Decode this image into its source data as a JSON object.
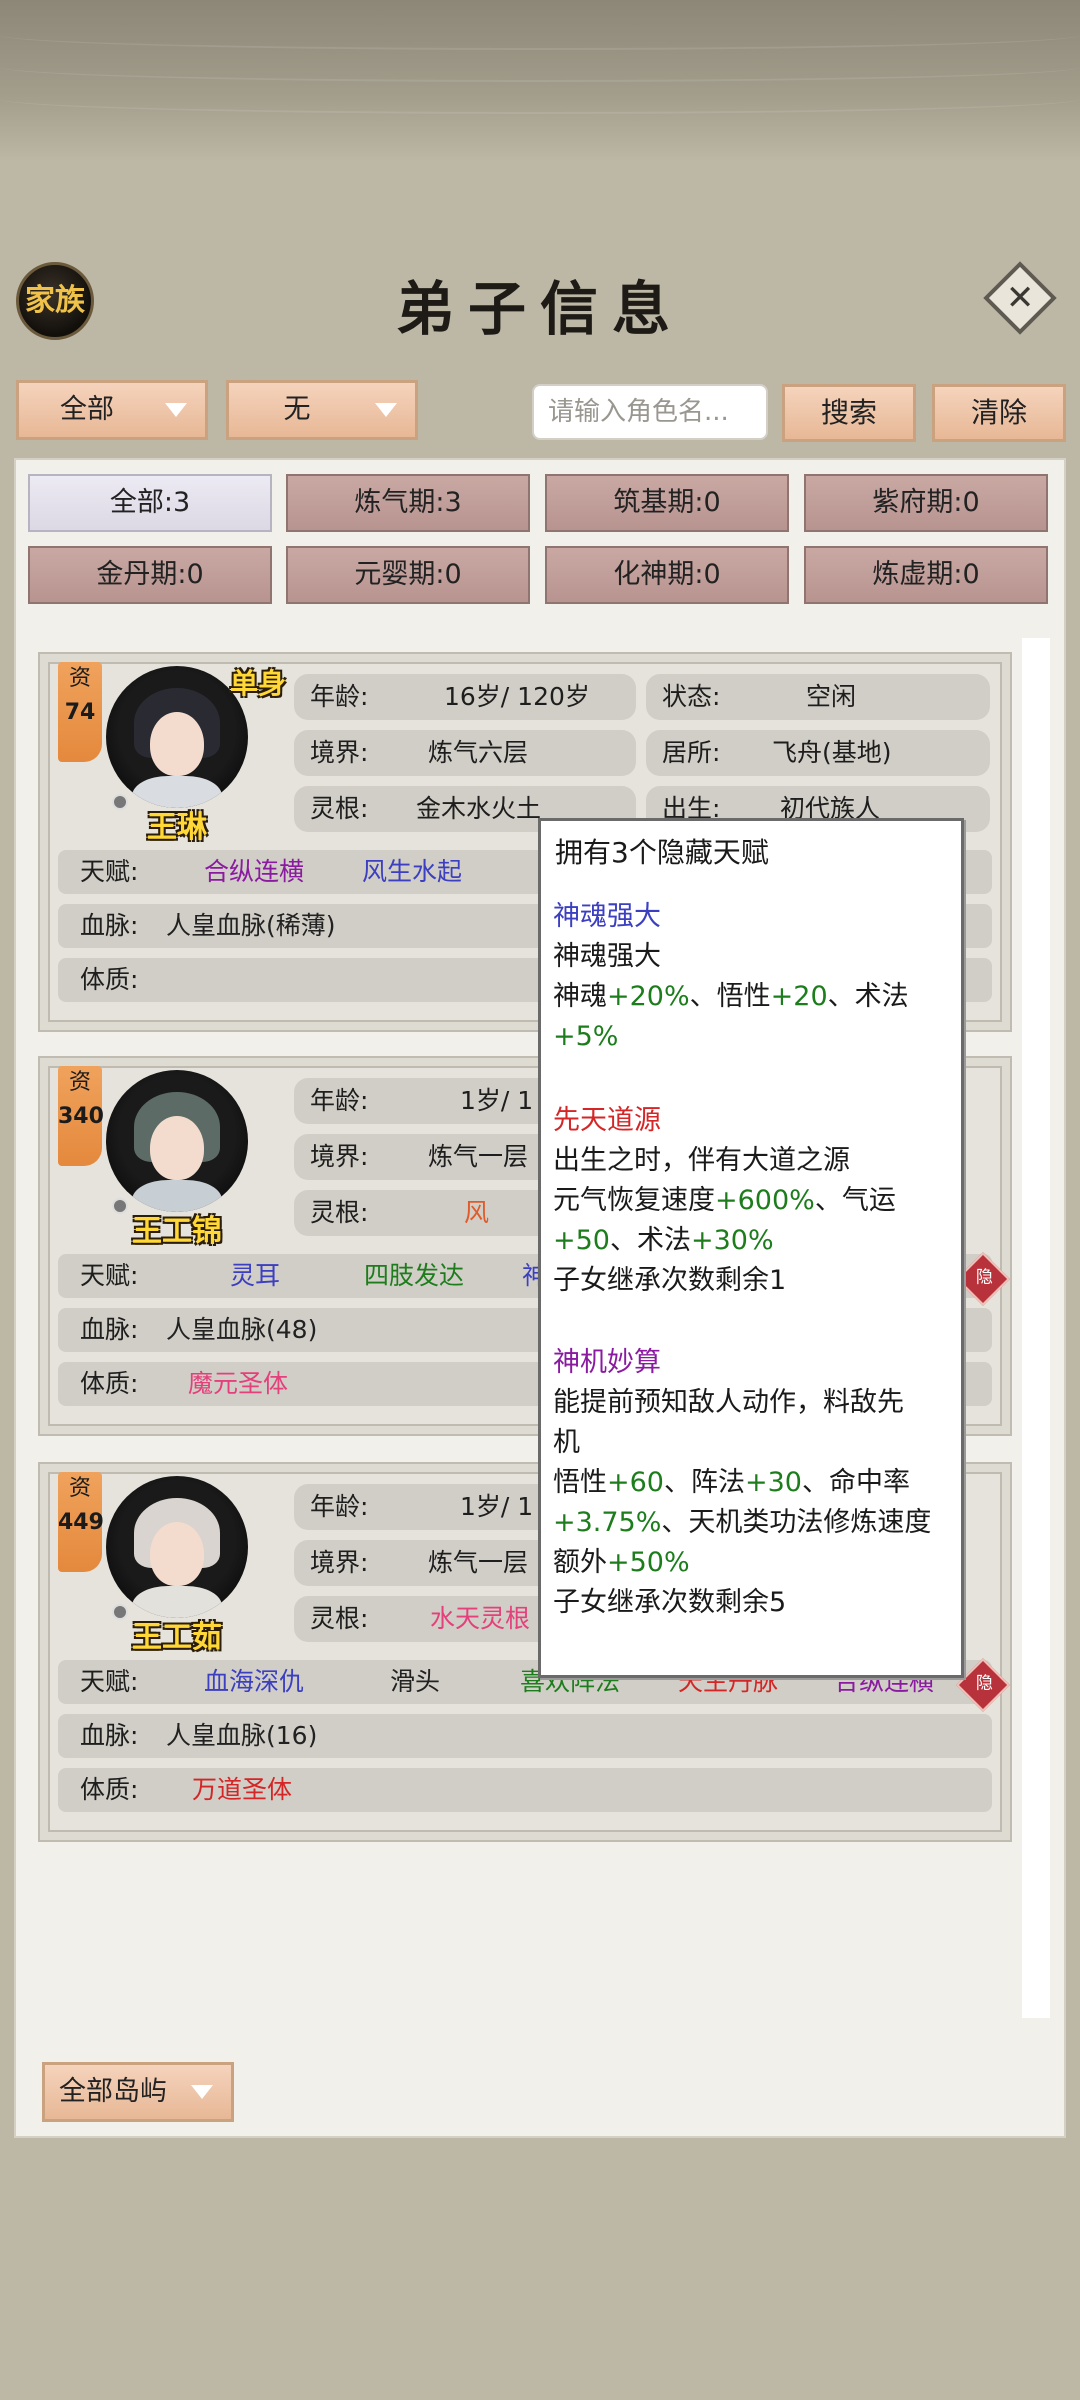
{
  "header": {
    "family_label": "家族",
    "title": "弟子信息"
  },
  "filters": {
    "group_dropdown": "全部",
    "second_dropdown": "无",
    "search_placeholder": "请输入角色名...",
    "search_label": "搜索",
    "clear_label": "清除"
  },
  "realm_tabs": [
    "全部:3",
    "炼气期:3",
    "筑基期:0",
    "紫府期:0",
    "金丹期:0",
    "元婴期:0",
    "化神期:0",
    "炼虚期:0"
  ],
  "labels": {
    "apt": "资",
    "age": "年龄:",
    "status": "状态:",
    "realm": "境界:",
    "residence": "居所:",
    "root": "灵根:",
    "birth": "出生:",
    "talent": "天赋:",
    "bloodline": "血脉:",
    "physique": "体质:",
    "hide_badge": "隐"
  },
  "disciples": [
    {
      "aptitude": "74",
      "name": "王琳",
      "tag": "单身",
      "age": "16岁/ 120岁",
      "status": "空闲",
      "realm": "炼气六层",
      "residence": "飞舟(基地)",
      "root": "金木水火土",
      "birth": "初代族人",
      "talents": [
        "合纵连横",
        "风生水起"
      ],
      "bloodline": "人皇血脉(稀薄)",
      "physique": ""
    },
    {
      "aptitude": "340",
      "name": "王工锦",
      "age": "1岁/ 1",
      "realm": "炼气一层",
      "root": "风",
      "talents": [
        "灵耳",
        "四肢发达",
        "神动"
      ],
      "bloodline": "人皇血脉(48)",
      "physique": "魔元圣体"
    },
    {
      "aptitude": "449",
      "name": "王工茹",
      "age": "1岁/ 1",
      "realm": "炼气一层",
      "root": "水天灵根",
      "talents": [
        "血海深仇",
        "滑头",
        "喜欢阵法",
        "天生丹脉",
        "合纵连横"
      ],
      "bloodline": "人皇血脉(16)",
      "physique": "万道圣体"
    }
  ],
  "island_dropdown": "全部岛屿",
  "tooltip": {
    "header": "拥有3个隐藏天赋",
    "t1_name": "神魂强大",
    "t1_desc": "神魂强大",
    "t1_e1": "神魂",
    "t1_v1": "+20%",
    "t1_e2": "、悟性",
    "t1_v2": "+20",
    "t1_e3": "、术法",
    "t1_v3": "+5%",
    "t2_name": "先天道源",
    "t2_desc": "出生之时，伴有大道之源",
    "t2_e1": "元气恢复速度",
    "t2_v1": "+600%",
    "t2_e2": "、气运",
    "t2_v2": "+50",
    "t2_e3": "、术法",
    "t2_v3": "+30%",
    "t2_inherit": "子女继承次数剩余1",
    "t3_name": "神机妙算",
    "t3_desc1": "能提前预知敌人动作，料敌先",
    "t3_desc2": "机",
    "t3_e1": "悟性",
    "t3_v1": "+60",
    "t3_e2": "、阵法",
    "t3_v2": "+30",
    "t3_e3": "、命中率",
    "t3_v3": "+3.75%",
    "t3_e4": "、天机类功法修炼速度",
    "t3_e5": "额外",
    "t3_v5": "+50%",
    "t3_inherit": "子女继承次数剩余5"
  },
  "colors": {
    "button_fill": "#e7b896",
    "realm_tab_fill": "#b89490",
    "name_yellow": "#ffd838",
    "effect_green": "#1d7d1d",
    "talent_blue": "#3b3fc0",
    "talent_red": "#d42626",
    "talent_purple": "#8a1aa0"
  }
}
